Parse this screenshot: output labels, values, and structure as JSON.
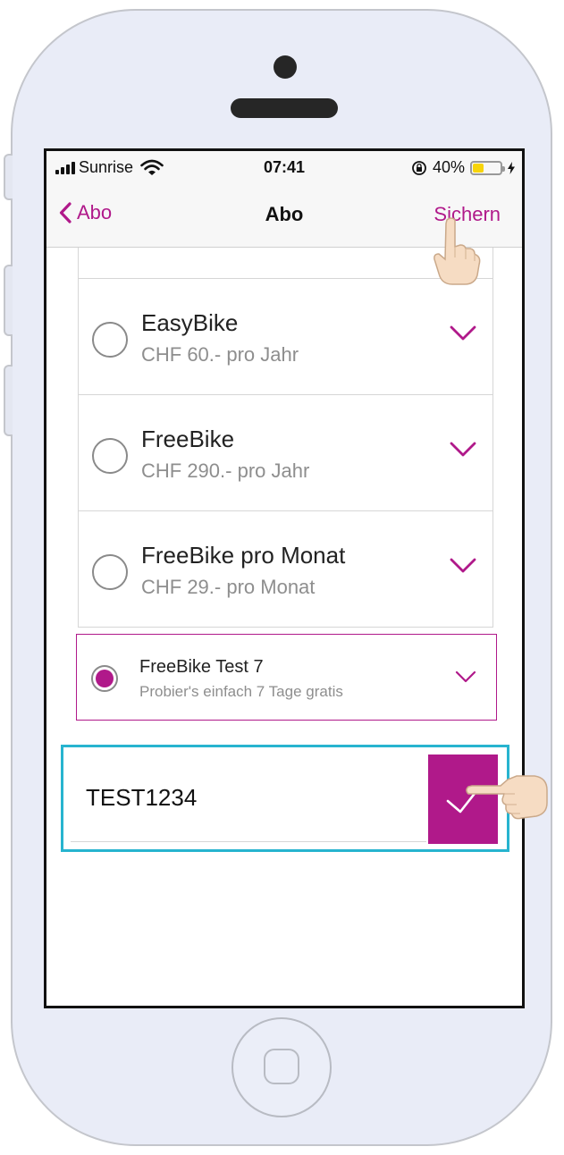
{
  "status_bar": {
    "carrier": "Sunrise",
    "time": "07:41",
    "battery": "40%",
    "battery_level": 0.4
  },
  "nav": {
    "back_label": "Abo",
    "title": "Abo",
    "save_label": "Sichern"
  },
  "options": [
    {
      "name": "EasyBike",
      "price": "CHF 60.- pro Jahr",
      "selected": false
    },
    {
      "name": "FreeBike",
      "price": "CHF 290.- pro Jahr",
      "selected": false
    },
    {
      "name": "FreeBike pro Monat",
      "price": "CHF 29.- pro Monat",
      "selected": false
    }
  ],
  "selected_option": {
    "name": "FreeBike Test 7",
    "subtitle": "Probier's einfach 7 Tage gratis",
    "selected": true
  },
  "promo_code": {
    "value": "TEST1234"
  },
  "colors": {
    "accent": "#b0198a",
    "highlight": "#27b4cf"
  },
  "icons": [
    "signal-icon",
    "wifi-icon",
    "rotation-lock-icon",
    "battery-icon",
    "charging-icon",
    "chevron-left-icon",
    "chevron-down-icon",
    "checkmark-icon",
    "pointing-hand-icon"
  ]
}
